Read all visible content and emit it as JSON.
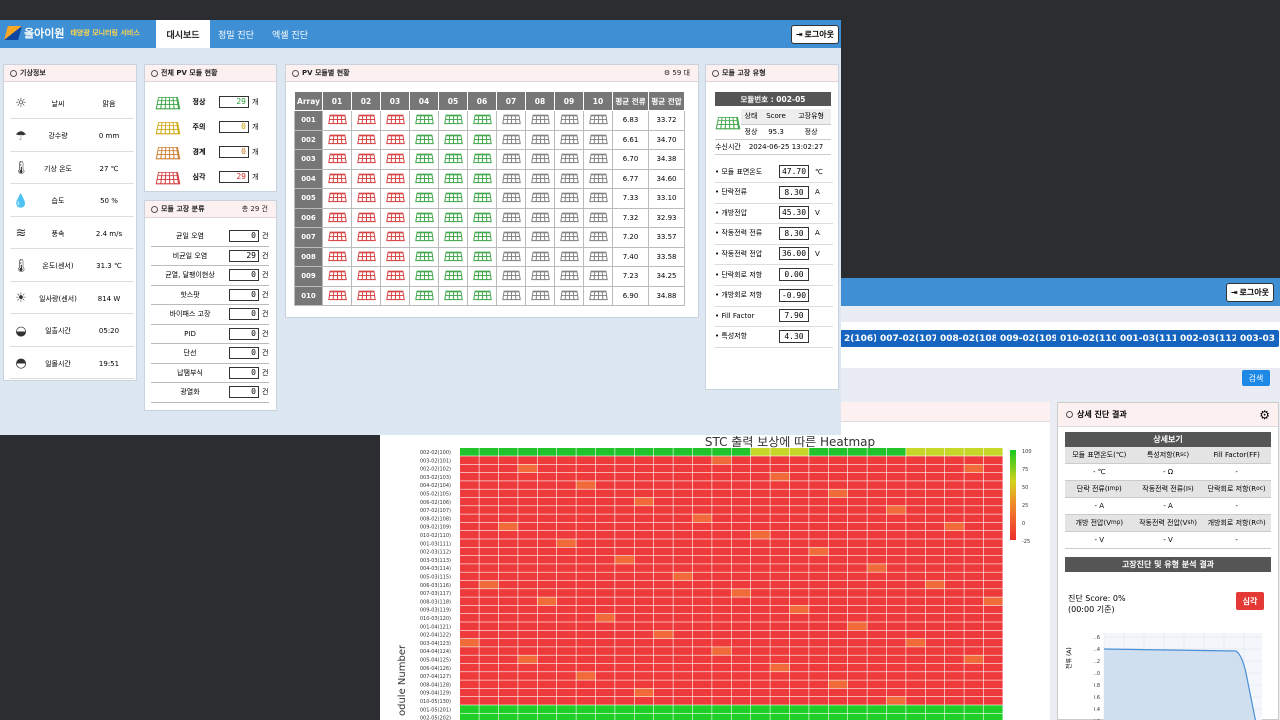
{
  "back_window": {
    "logout_label": "로그아웃",
    "module_buttons": [
      "2(106)",
      "007-02(107)",
      "008-02(108)",
      "009-02(109)",
      "010-02(110)",
      "001-03(111)",
      "002-03(112)",
      "003-03"
    ],
    "search_label": "검색",
    "heatmap": {
      "title": "STC 출력 보상에 따른 Heatmap",
      "ylabel": "odule Number",
      "rows": [
        "002-02(100)",
        "003-02(101)",
        "002-02(102)",
        "003-02(103)",
        "004-02(104)",
        "005-02(105)",
        "006-02(106)",
        "007-02(107)",
        "008-02(108)",
        "009-02(109)",
        "010-02(110)",
        "001-03(111)",
        "002-03(112)",
        "003-03(113)",
        "004-03(114)",
        "005-03(115)",
        "006-03(116)",
        "007-03(117)",
        "008-03(118)",
        "009-03(119)",
        "010-03(120)",
        "001-04(121)",
        "002-04(122)",
        "003-04(123)",
        "004-04(124)",
        "005-04(125)",
        "006-04(126)",
        "007-04(127)",
        "008-04(128)",
        "009-04(129)",
        "010-05(130)",
        "001-05(201)",
        "002-05(202)"
      ],
      "colorbar_ticks": [
        "100",
        "75",
        "50",
        "25",
        "0",
        "-25"
      ]
    },
    "diagnosis": {
      "title": "상세 진단 결과",
      "detail_header": "상세보기",
      "grid": [
        [
          "모듈 표면온도(℃)",
          "특성저항(R",
          "Fill Factor(FF)"
        ],
        [
          "- ℃",
          "- Ω",
          "-"
        ],
        [
          "단락 전류(I",
          "작동전력 전류(I",
          "단락회로 저항(R"
        ],
        [
          "- A",
          "- A",
          "-"
        ],
        [
          "개방 전압(V",
          "작동전력 전압(V",
          "개방회로 저항(R"
        ],
        [
          "- V",
          "- V",
          "-"
        ]
      ],
      "subscripts": [
        [
          "sc"
        ],
        [
          "mp"
        ],
        [
          "s"
        ],
        [
          "oc"
        ],
        [
          "mp"
        ],
        [
          "sh"
        ],
        [
          "ch"
        ]
      ],
      "analysis_header": "고장진단 및 유형 분석 결과",
      "score_line": "진단 Score: 0%",
      "time_line": "(00:00 기준)",
      "severity_label": "심각",
      "plot_yticks": [
        "1.6",
        "1.4",
        "1.2",
        "1.0",
        "0.8",
        "0.6",
        "0.4",
        "0.2"
      ],
      "plot_ylabel": "전류 (A)"
    }
  },
  "dashboard": {
    "logo_name": "올아이원",
    "logo_sub": "태양광 모니터링 서비스",
    "tabs": [
      "대시보드",
      "정밀 진단",
      "엑셀 진단"
    ],
    "active_tab": 0,
    "logout_label": "로그아웃",
    "weather": {
      "title": "기상정보",
      "rows": [
        {
          "icon": "sun-icon",
          "glyph": "☼",
          "label": "날씨",
          "value": "맑음"
        },
        {
          "icon": "rain-icon",
          "glyph": "☂",
          "label": "강수량",
          "value": "0 mm"
        },
        {
          "icon": "thermometer-icon",
          "glyph": "🌡",
          "label": "기상 온도",
          "value": "27 ℃"
        },
        {
          "icon": "humidity-icon",
          "glyph": "💧",
          "label": "습도",
          "value": "50 %"
        },
        {
          "icon": "wind-icon",
          "glyph": "≋",
          "label": "풍속",
          "value": "2.4 m/s"
        },
        {
          "icon": "thermometer-icon",
          "glyph": "🌡",
          "label": "온도(센서)",
          "value": "31.3 ℃"
        },
        {
          "icon": "irradiance-icon",
          "glyph": "☀",
          "label": "일사량(센서)",
          "value": "814 W"
        },
        {
          "icon": "sunrise-icon",
          "glyph": "◒",
          "label": "일출시간",
          "value": "05:20"
        },
        {
          "icon": "sunset-icon",
          "glyph": "◓",
          "label": "일몰시간",
          "value": "19:51"
        }
      ]
    },
    "status": {
      "title": "전체 PV 모듈 현황",
      "rows": [
        {
          "label": "정상",
          "value": "29",
          "unit": "개",
          "level": "normal",
          "color": "#2e9e3a"
        },
        {
          "label": "주의",
          "value": "0",
          "unit": "개",
          "level": "warn",
          "color": "#c9a200"
        },
        {
          "label": "경계",
          "value": "0",
          "unit": "개",
          "level": "alert",
          "color": "#c7751f"
        },
        {
          "label": "심각",
          "value": "29",
          "unit": "개",
          "level": "severe",
          "color": "#d32f2f"
        }
      ]
    },
    "faults": {
      "title": "모듈 고장 분류",
      "total": "총 29 건",
      "rows": [
        {
          "label": "균일 오염",
          "value": "0",
          "unit": "건"
        },
        {
          "label": "비균일 오염",
          "value": "29",
          "unit": "건"
        },
        {
          "label": "균열, 달팽이현상",
          "value": "0",
          "unit": "건"
        },
        {
          "label": "핫스팟",
          "value": "0",
          "unit": "건"
        },
        {
          "label": "바이패스 고장",
          "value": "0",
          "unit": "건"
        },
        {
          "label": "PID",
          "value": "0",
          "unit": "건"
        },
        {
          "label": "단선",
          "value": "0",
          "unit": "건"
        },
        {
          "label": "납땜부식",
          "value": "0",
          "unit": "건"
        },
        {
          "label": "광열화",
          "value": "0",
          "unit": "건"
        }
      ]
    },
    "pv_grid": {
      "title": "PV 모듈별 현황",
      "count": "59 대",
      "headers": [
        "Array",
        "01",
        "02",
        "03",
        "04",
        "05",
        "06",
        "07",
        "08",
        "09",
        "10",
        "평균 전류",
        "평균 전압"
      ],
      "rows": [
        {
          "array": "001",
          "cells": [
            "s",
            "s",
            "s",
            "n",
            "n",
            "n",
            "o",
            "o",
            "o",
            "o"
          ],
          "current": "6.83",
          "voltage": "33.72"
        },
        {
          "array": "002",
          "cells": [
            "s",
            "s",
            "s",
            "n",
            "n",
            "n",
            "o",
            "o",
            "o",
            "o"
          ],
          "current": "6.61",
          "voltage": "34.70"
        },
        {
          "array": "003",
          "cells": [
            "s",
            "s",
            "s",
            "n",
            "n",
            "n",
            "o",
            "o",
            "o",
            "o"
          ],
          "current": "6.70",
          "voltage": "34.38"
        },
        {
          "array": "004",
          "cells": [
            "s",
            "s",
            "s",
            "n",
            "n",
            "n",
            "o",
            "o",
            "o",
            "o"
          ],
          "current": "6.77",
          "voltage": "34.60"
        },
        {
          "array": "005",
          "cells": [
            "s",
            "s",
            "s",
            "n",
            "n",
            "n",
            "o",
            "o",
            "o",
            "o"
          ],
          "current": "7.33",
          "voltage": "33.10"
        },
        {
          "array": "006",
          "cells": [
            "s",
            "s",
            "s",
            "n",
            "n",
            "n",
            "o",
            "o",
            "o",
            "o"
          ],
          "current": "7.32",
          "voltage": "32.93"
        },
        {
          "array": "007",
          "cells": [
            "s",
            "s",
            "s",
            "n",
            "n",
            "n",
            "o",
            "o",
            "o",
            "o"
          ],
          "current": "7.20",
          "voltage": "33.57"
        },
        {
          "array": "008",
          "cells": [
            "s",
            "s",
            "s",
            "n",
            "n",
            "n",
            "o",
            "o",
            "o",
            "o"
          ],
          "current": "7.40",
          "voltage": "33.58"
        },
        {
          "array": "009",
          "cells": [
            "s",
            "s",
            "s",
            "n",
            "n",
            "n",
            "o",
            "o",
            "o",
            "o"
          ],
          "current": "7.23",
          "voltage": "34.25"
        },
        {
          "array": "010",
          "cells": [
            "s",
            "s",
            "s",
            "n",
            "n",
            "n",
            "o",
            "o",
            "o",
            "o"
          ],
          "current": "6.90",
          "voltage": "34.88"
        }
      ]
    },
    "fault_type": {
      "title": "모듈 고장 유형",
      "module_no": "모듈번호 : 002-05",
      "table_headers": [
        "상태",
        "Score",
        "고장유형"
      ],
      "table_values": [
        "정상",
        "95.3",
        "정상"
      ],
      "recv_label": "수신시간",
      "recv_time": "2024-06-25 13:02:27",
      "params": [
        {
          "label": "• 모듈 표면온도",
          "value": "47.70",
          "unit": "℃"
        },
        {
          "label": "• 단락전류",
          "value": "8.30",
          "unit": "A"
        },
        {
          "label": "• 개방전압",
          "value": "45.30",
          "unit": "V"
        },
        {
          "label": "• 작동전력 전류",
          "value": "8.30",
          "unit": "A"
        },
        {
          "label": "• 작동전력 전압",
          "value": "36.00",
          "unit": "V"
        },
        {
          "label": "• 단락회로 저항",
          "value": "0.00",
          "unit": ""
        },
        {
          "label": "• 개방회로 저항",
          "value": "-0.90",
          "unit": ""
        },
        {
          "label": "• Fill Factor",
          "value": "7.90",
          "unit": ""
        },
        {
          "label": "• 특성저항",
          "value": "4.30",
          "unit": ""
        }
      ]
    }
  }
}
